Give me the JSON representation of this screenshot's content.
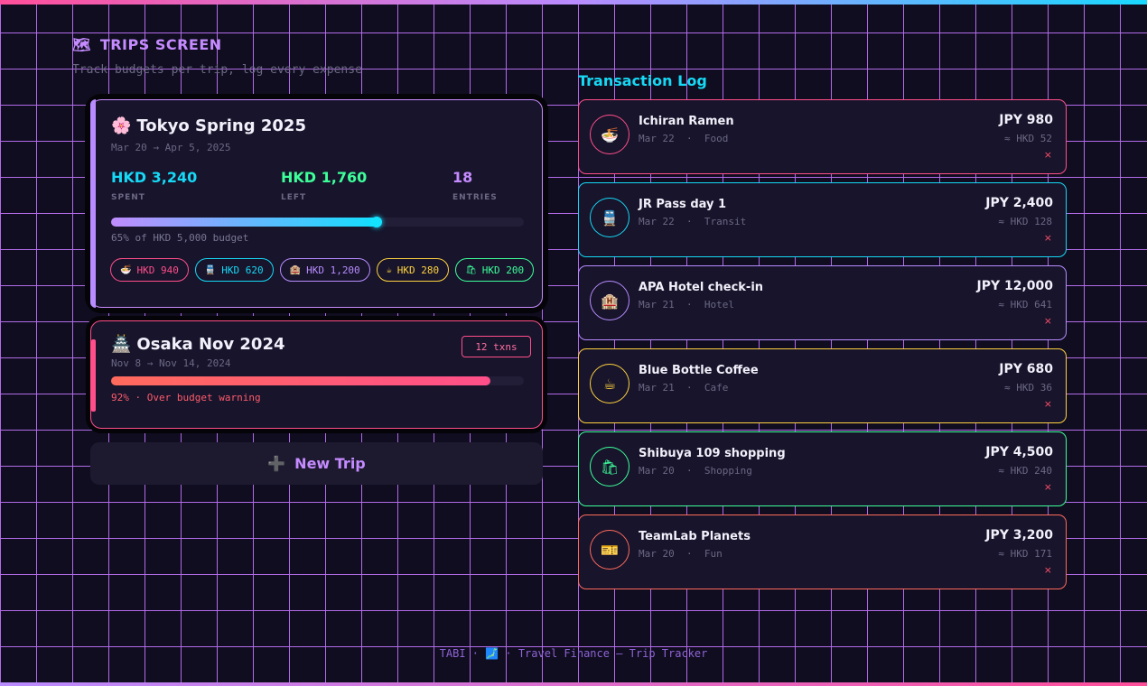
{
  "colors": {
    "pink": "#ff4f8a",
    "cyan": "#16d9f6",
    "purple": "#b98cff",
    "yellow": "#ffd23f",
    "green": "#3dff9a",
    "orange": "#ff6a5c",
    "bg": "#0f0d1f"
  },
  "header": {
    "icon": "map-icon",
    "title": "TRIPS SCREEN",
    "subtitle": "Track budgets per trip, log every expense"
  },
  "trips": [
    {
      "icon": "cherry-blossom-icon",
      "title": "Tokyo Spring 2025",
      "dates": "Mar 20 → Apr 5, 2025",
      "spent": "HKD 3,240",
      "spent_label": "SPENT",
      "left": "HKD 1,760",
      "left_label": "LEFT",
      "entries": "18",
      "entries_label": "ENTRIES",
      "progress": 0.65,
      "progress_caption": "65% of HKD 5,000 budget",
      "chips": [
        {
          "icon": "ramen-icon",
          "glyph": "🍜",
          "label": "HKD 940",
          "color": "#ff4f8a"
        },
        {
          "icon": "train-icon",
          "glyph": "🚆",
          "label": "HKD 620",
          "color": "#16d9f6"
        },
        {
          "icon": "hotel-icon",
          "glyph": "🏨",
          "label": "HKD 1,200",
          "color": "#b98cff"
        },
        {
          "icon": "coffee-icon",
          "glyph": "☕",
          "label": "HKD 280",
          "color": "#ffd23f"
        },
        {
          "icon": "shopping-icon",
          "glyph": "🛍",
          "label": "HKD 200",
          "color": "#3dff9a"
        }
      ]
    },
    {
      "icon": "castle-icon",
      "title": "Osaka Nov 2024",
      "dates": "Nov 8 → Nov 14, 2024",
      "badge": "12 txns",
      "progress": 0.92,
      "progress_caption": "92% · Over budget warning"
    }
  ],
  "new_trip": {
    "icon": "plus-icon",
    "label": "New Trip"
  },
  "log": {
    "title": "Transaction Log",
    "items": [
      {
        "icon": "ramen-icon",
        "glyph": "🍜",
        "name": "Ichiran Ramen",
        "meta": "Mar 22  ·  Food",
        "amount": "JPY 980",
        "conv": "≈ HKD 52",
        "color": "#ff4f8a"
      },
      {
        "icon": "train-icon",
        "glyph": "🚆",
        "name": "JR Pass day 1",
        "meta": "Mar 22  ·  Transit",
        "amount": "JPY 2,400",
        "conv": "≈ HKD 128",
        "color": "#16d9f6"
      },
      {
        "icon": "hotel-icon",
        "glyph": "🏨",
        "name": "APA Hotel check-in",
        "meta": "Mar 21  ·  Hotel",
        "amount": "JPY 12,000",
        "conv": "≈ HKD 641",
        "color": "#b98cff"
      },
      {
        "icon": "coffee-icon",
        "glyph": "☕",
        "name": "Blue Bottle Coffee",
        "meta": "Mar 21  ·  Cafe",
        "amount": "JPY 680",
        "conv": "≈ HKD 36",
        "color": "#ffd23f"
      },
      {
        "icon": "shopping-icon",
        "glyph": "🛍",
        "name": "Shibuya 109 shopping",
        "meta": "Mar 20  ·  Shopping",
        "amount": "JPY 4,500",
        "conv": "≈ HKD 240",
        "color": "#3dff9a"
      },
      {
        "icon": "ticket-icon",
        "glyph": "🎫",
        "name": "TeamLab Planets",
        "meta": "Mar 20  ·  Fun",
        "amount": "JPY 3,200",
        "conv": "≈ HKD 171",
        "color": "#ff6a5c"
      }
    ],
    "delete_glyph": "×"
  },
  "footer": "TABI · 🗾 · Travel Finance — Trip Tracker"
}
